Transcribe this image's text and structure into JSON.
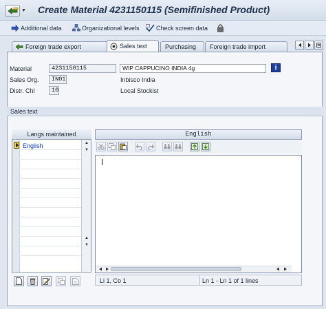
{
  "window": {
    "title": "Create Material 4231150115 (Semifinished Product)"
  },
  "app_toolbar": {
    "items": [
      {
        "label": "Additional data",
        "icon": "arrow-right-icon"
      },
      {
        "label": "Organizational levels",
        "icon": "org-levels-icon"
      },
      {
        "label": "Check screen data",
        "icon": "check-screen-icon"
      },
      {
        "label": "",
        "icon": "lock-icon"
      }
    ]
  },
  "tabs": [
    {
      "label": "Foreign trade export",
      "active": false
    },
    {
      "label": "Sales text",
      "active": true
    },
    {
      "label": "Purchasing",
      "active": false
    },
    {
      "label": "Foreign trade import",
      "active": false
    }
  ],
  "header_fields": {
    "material_label": "Material",
    "material_value": "4231150115",
    "material_desc": "WIP CAPPUCINO INDIA 4g",
    "sales_org_label": "Sales Org.",
    "sales_org_value": "IN01",
    "sales_org_desc": "Inbisco India",
    "distr_chl_label": "Distr. Chl",
    "distr_chl_value": "10",
    "distr_chl_desc": "Local Stockist"
  },
  "sales_text": {
    "group_title": "Sales text",
    "langs_header": "Langs maintained",
    "languages": [
      "English"
    ],
    "editor_language": "English",
    "editor_content": "",
    "status_position": "Li 1, Co 1",
    "status_lines": "Ln 1 - Ln 1 of 1 lines"
  },
  "colors": {
    "title": "#1c2f4a",
    "selected_language": "#0a3bd4",
    "info_button": "#1e3f9b"
  }
}
